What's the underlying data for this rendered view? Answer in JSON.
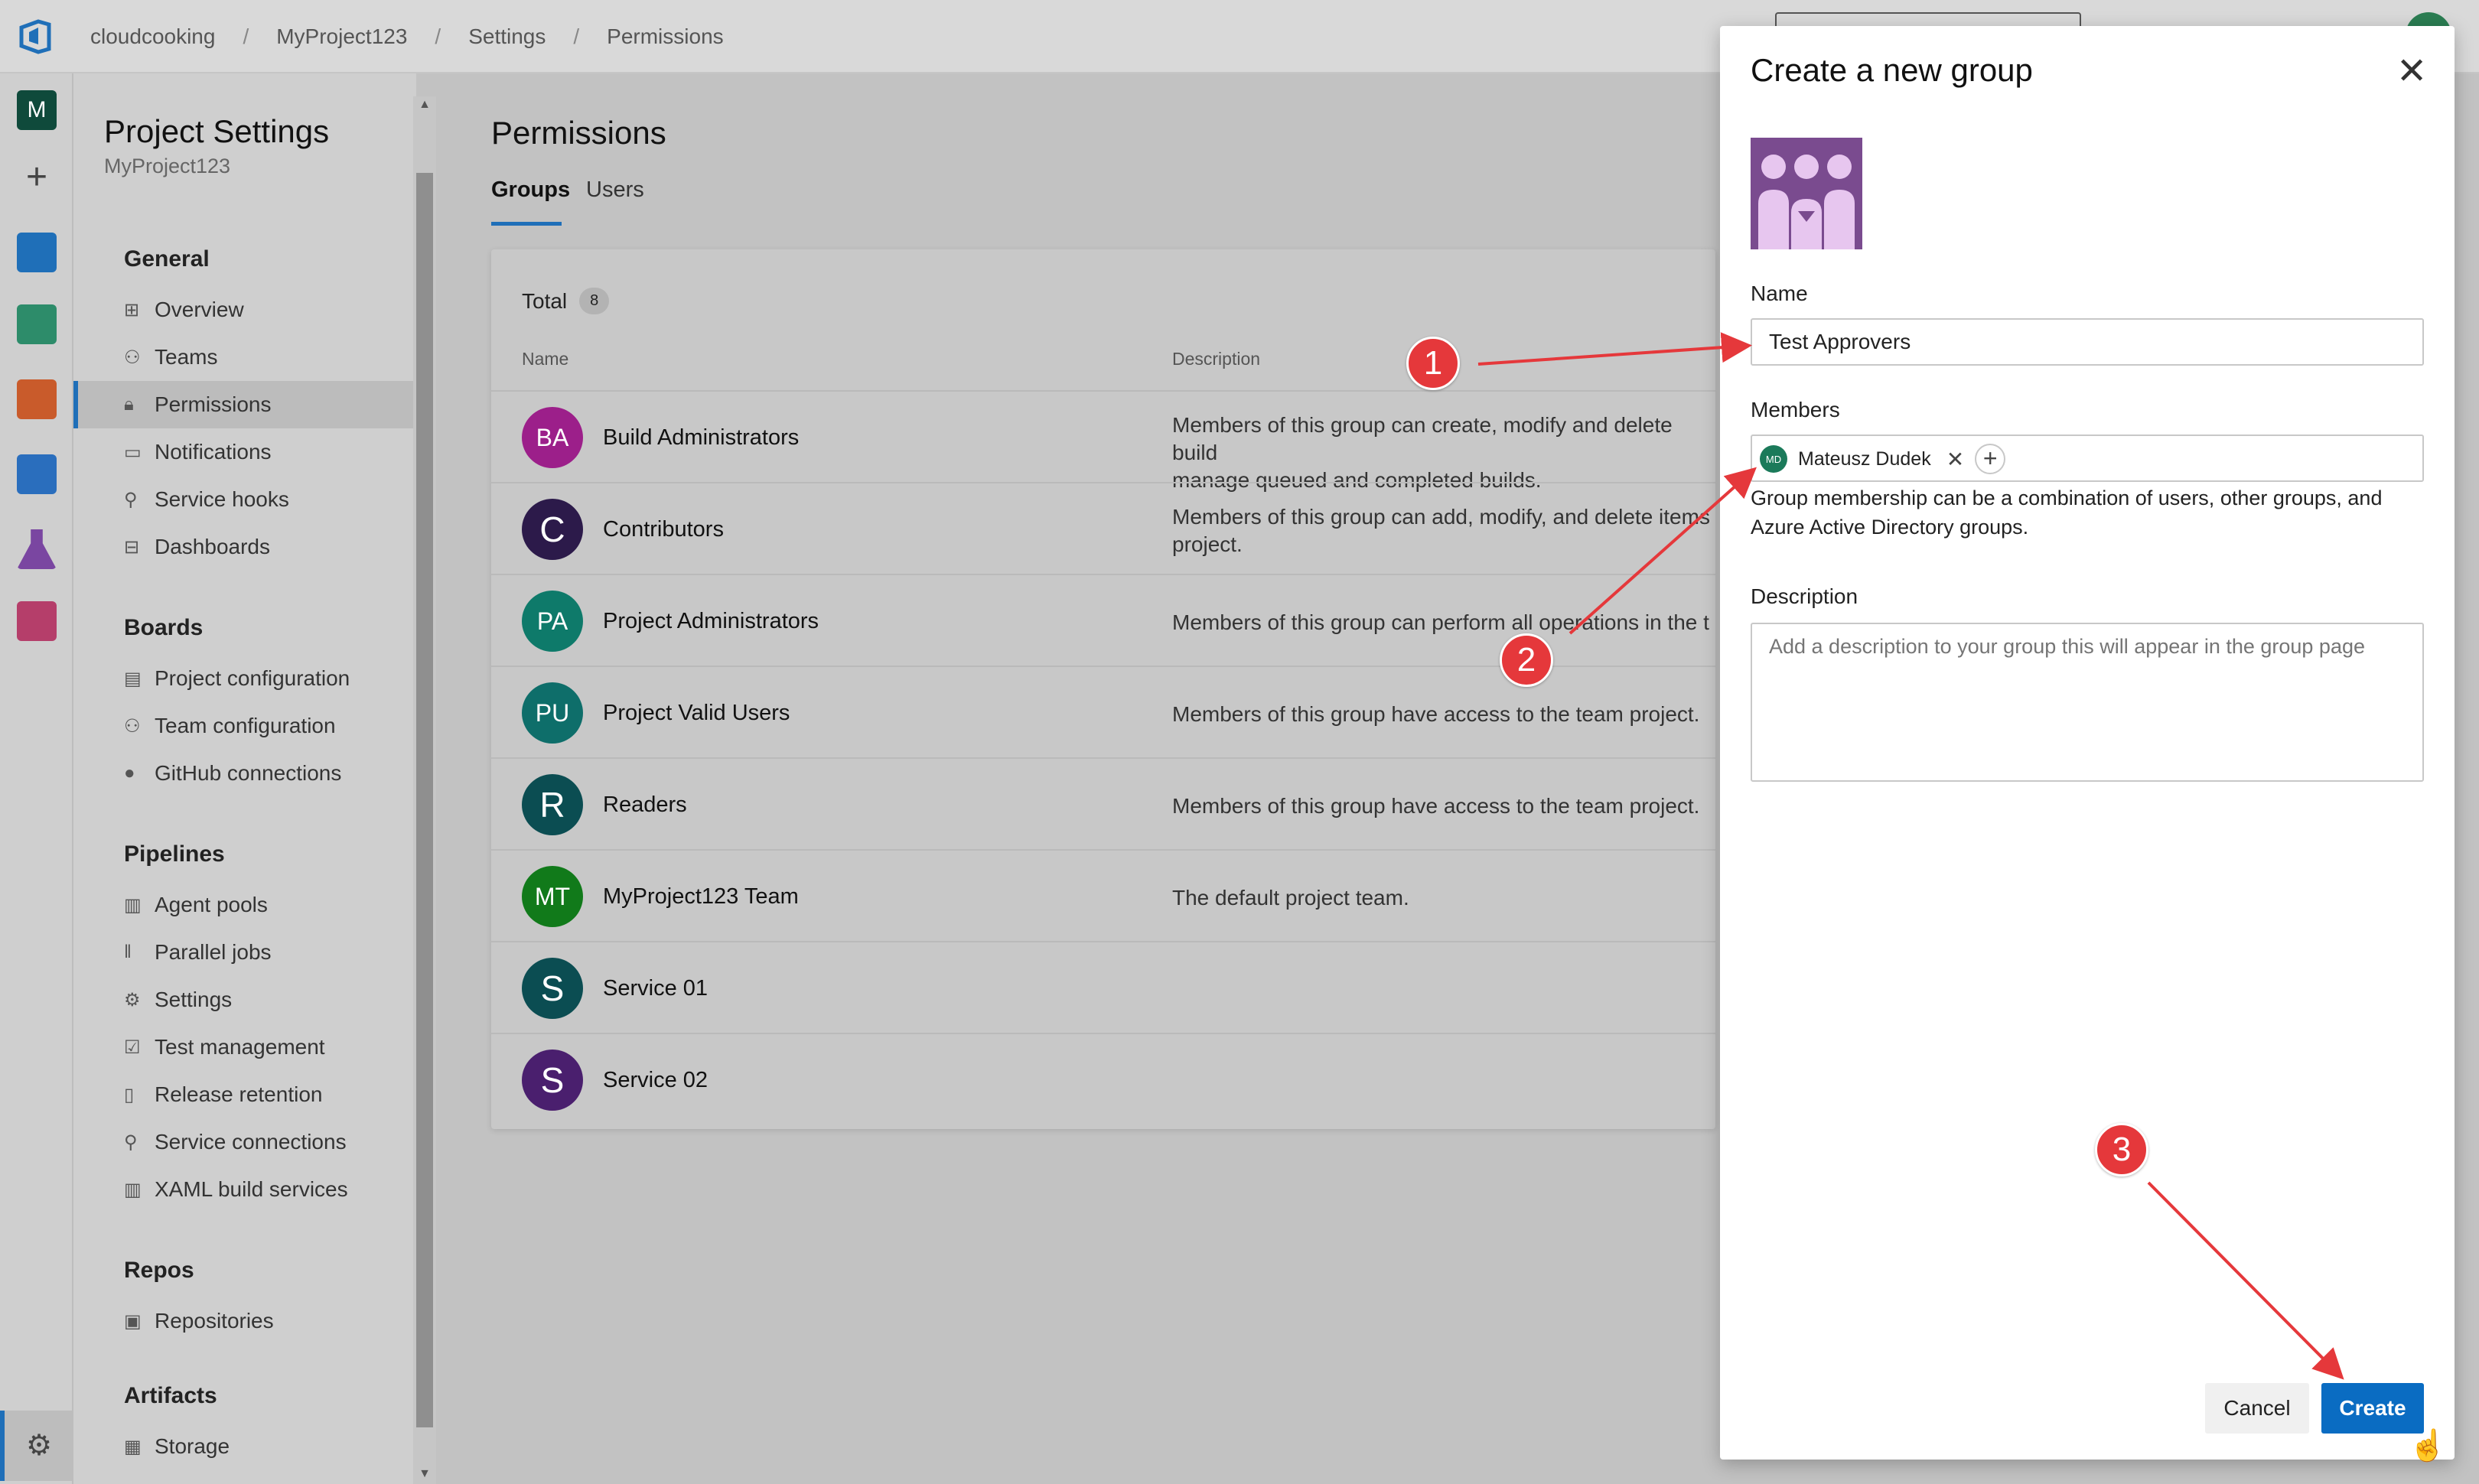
{
  "breadcrumb": [
    "cloudcooking",
    "MyProject123",
    "Settings",
    "Permissions"
  ],
  "rail": {
    "avatar_letter": "M"
  },
  "settings_nav": {
    "title": "Project Settings",
    "subtitle": "MyProject123",
    "sections": [
      {
        "label": "General",
        "items": [
          {
            "label": "Overview",
            "icon": "overview-icon"
          },
          {
            "label": "Teams",
            "icon": "teams-icon"
          },
          {
            "label": "Permissions",
            "icon": "lock-icon",
            "active": true
          },
          {
            "label": "Notifications",
            "icon": "notification-icon"
          },
          {
            "label": "Service hooks",
            "icon": "hook-icon"
          },
          {
            "label": "Dashboards",
            "icon": "dashboard-icon"
          }
        ]
      },
      {
        "label": "Boards",
        "items": [
          {
            "label": "Project configuration",
            "icon": "document-icon"
          },
          {
            "label": "Team configuration",
            "icon": "team-config-icon"
          },
          {
            "label": "GitHub connections",
            "icon": "github-icon"
          }
        ]
      },
      {
        "label": "Pipelines",
        "items": [
          {
            "label": "Agent pools",
            "icon": "agent-pool-icon"
          },
          {
            "label": "Parallel jobs",
            "icon": "parallel-icon"
          },
          {
            "label": "Settings",
            "icon": "gear-icon"
          },
          {
            "label": "Test management",
            "icon": "test-icon"
          },
          {
            "label": "Release retention",
            "icon": "phone-icon"
          },
          {
            "label": "Service connections",
            "icon": "plug-icon"
          },
          {
            "label": "XAML build services",
            "icon": "build-icon"
          }
        ]
      },
      {
        "label": "Repos",
        "items": [
          {
            "label": "Repositories",
            "icon": "repo-icon"
          }
        ]
      },
      {
        "label": "Artifacts",
        "items": [
          {
            "label": "Storage",
            "icon": "storage-icon"
          }
        ]
      }
    ]
  },
  "main": {
    "title": "Permissions",
    "tabs": [
      "Groups",
      "Users"
    ],
    "total_label": "Total",
    "total_count": "8",
    "columns": [
      "Name",
      "Description"
    ],
    "groups": [
      {
        "initials": "BA",
        "name": "Build Administrators",
        "description": "Members of this group can create, modify and delete build\nmanage queued and completed builds.",
        "color": "#9c1f8a"
      },
      {
        "initials": "C",
        "name": "Contributors",
        "description": "Members of this group can add, modify, and delete items\nproject.",
        "color": "#2c1a4a"
      },
      {
        "initials": "PA",
        "name": "Project Administrators",
        "description": "Members of this group can perform all operations in the t",
        "color": "#0e7a6a"
      },
      {
        "initials": "PU",
        "name": "Project Valid Users",
        "description": "Members of this group have access to the team project.",
        "color": "#0e6e6a"
      },
      {
        "initials": "R",
        "name": "Readers",
        "description": "Members of this group have access to the team project.",
        "color": "#0b4d52"
      },
      {
        "initials": "MT",
        "name": "MyProject123 Team",
        "description": "The default project team.",
        "color": "#117a1a"
      },
      {
        "initials": "S",
        "name": "Service 01",
        "description": "",
        "color": "#0b4d52"
      },
      {
        "initials": "S",
        "name": "Service 02",
        "description": "",
        "color": "#4a1f6e"
      }
    ]
  },
  "dialog": {
    "title": "Create a new group",
    "name_label": "Name",
    "name_value": "Test Approvers",
    "members_label": "Members",
    "member": {
      "initials": "MD",
      "name": "Mateusz Dudek"
    },
    "members_help": "Group membership can be a combination of users, other groups, and Azure Active Directory groups.",
    "description_label": "Description",
    "description_placeholder": "Add a description to your group this will appear in the group page",
    "cancel_label": "Cancel",
    "create_label": "Create"
  },
  "annotations": [
    "1",
    "2",
    "3"
  ],
  "colors": {
    "accent": "#0a6cc2",
    "marker": "#e5383b",
    "group_image": "#7a4b8f"
  }
}
